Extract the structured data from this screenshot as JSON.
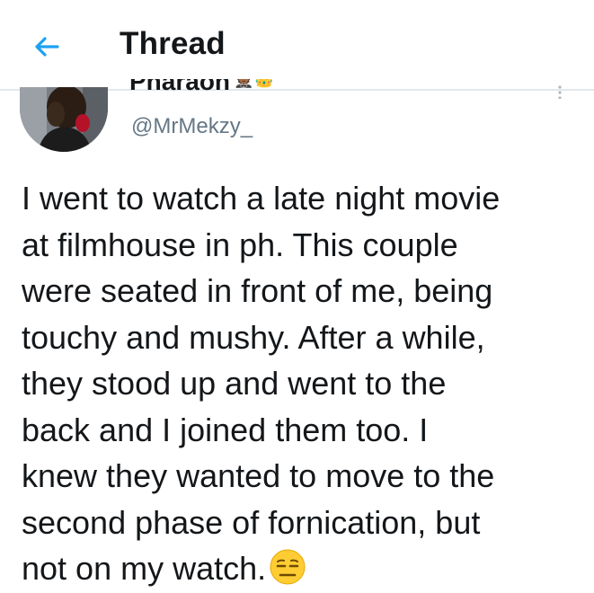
{
  "header": {
    "title": "Thread",
    "back_icon": "arrow-left-icon"
  },
  "author": {
    "display_name": "Pharaoh",
    "display_name_emojis": "🤵🏾👑",
    "handle": "@MrMekzy_",
    "more_icon": "more-vertical-icon"
  },
  "tweet": {
    "lines": [
      "I went to watch a late night movie",
      "at filmhouse in ph. This couple",
      "were seated in front of me, being",
      "touchy and mushy. After a while,",
      "they stood up and went to the",
      "back and I joined them too. I",
      "knew they wanted to move to the",
      "second phase of fornication, but",
      "not on my watch."
    ],
    "trailing_emoji": "expressionless-face-emoji"
  },
  "colors": {
    "accent": "#1da1f2",
    "text": "#14171a",
    "secondary_text": "#657786",
    "divider": "#e1e8ed",
    "emoji_yellow": "#ffcc33"
  }
}
